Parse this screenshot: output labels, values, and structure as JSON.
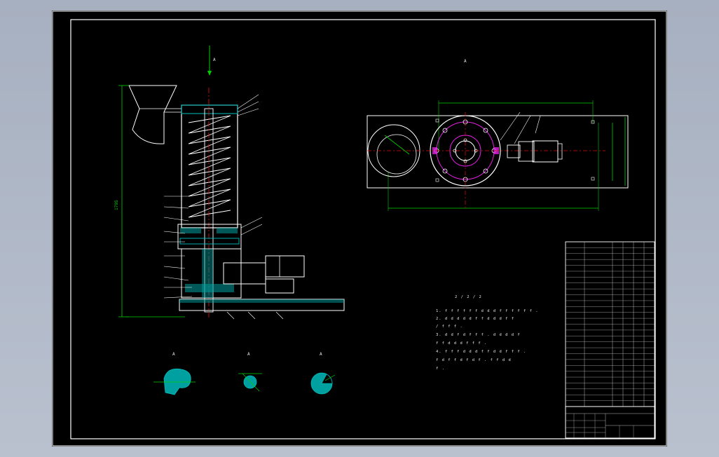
{
  "drawing": {
    "height_dim": "1795",
    "view_a_label": "A",
    "view_b_label": "A",
    "sec_labels": [
      "A",
      "A",
      "A"
    ],
    "notes_title": "2 / 2 / 2",
    "notes_lines": [
      "1. f f f f f f  d  d  d  f  f  f  f  f  f .",
      "2. d  d  d  d  d  f  f  d  d  d  f  f",
      "/ f  f  f .",
      "3. d  d  f  d  f  f  f .  d  d  d  d  f",
      "f f  d  d  d  f  f  f .",
      "4. f  f  f  d  d  d  f  f  d  d  f  f  f .",
      "f  d  f  f  d  f  d  f  .  f  f  d  d",
      "f ."
    ]
  },
  "colors": {
    "background": "#000000",
    "outline": "#ffffff",
    "dimension": "#00d000",
    "centerline": "#e01010",
    "hatch": "#00c0c0",
    "bolt_circle": "#e020e0",
    "shaft_fill": "#00a0a0"
  },
  "title_block": {
    "rows": 28,
    "cells": [
      "",
      "",
      "",
      ""
    ],
    "name_cell": "",
    "drawing_no": ""
  }
}
